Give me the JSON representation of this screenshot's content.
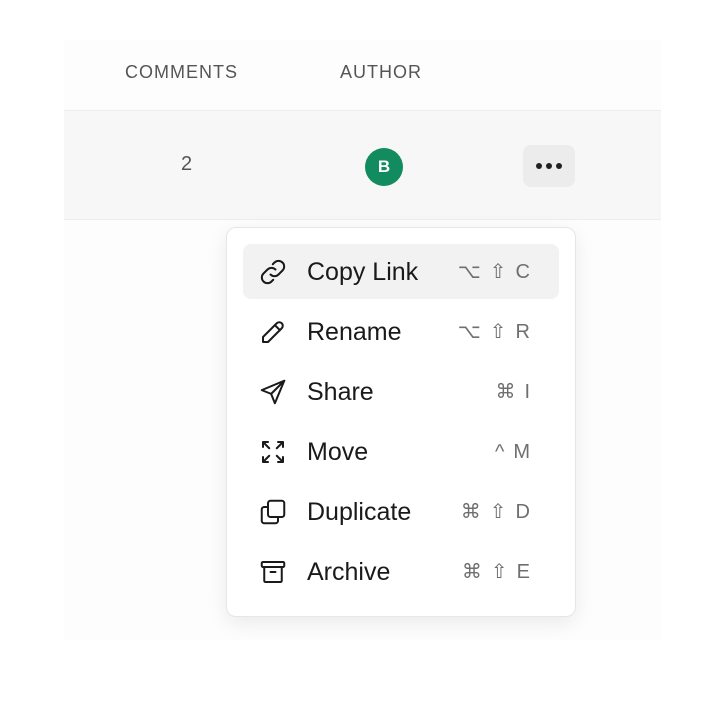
{
  "table": {
    "headers": {
      "comments": "COMMENTS",
      "author": "AUTHOR"
    },
    "row": {
      "comments": "2",
      "author_initial": "B"
    }
  },
  "colors": {
    "avatar": "#128c5e",
    "menu_active_bg": "#f2f2f2"
  },
  "menu": {
    "items": [
      {
        "label": "Copy Link",
        "icon": "link-icon",
        "shortcut": "⌥⇧C"
      },
      {
        "label": "Rename",
        "icon": "pencil-icon",
        "shortcut": "⌥⇧R"
      },
      {
        "label": "Share",
        "icon": "send-icon",
        "shortcut": "⌘I"
      },
      {
        "label": "Move",
        "icon": "move-icon",
        "shortcut": "^M"
      },
      {
        "label": "Duplicate",
        "icon": "duplicate-icon",
        "shortcut": "⌘⇧D"
      },
      {
        "label": "Archive",
        "icon": "archive-icon",
        "shortcut": "⌘⇧E"
      }
    ]
  }
}
